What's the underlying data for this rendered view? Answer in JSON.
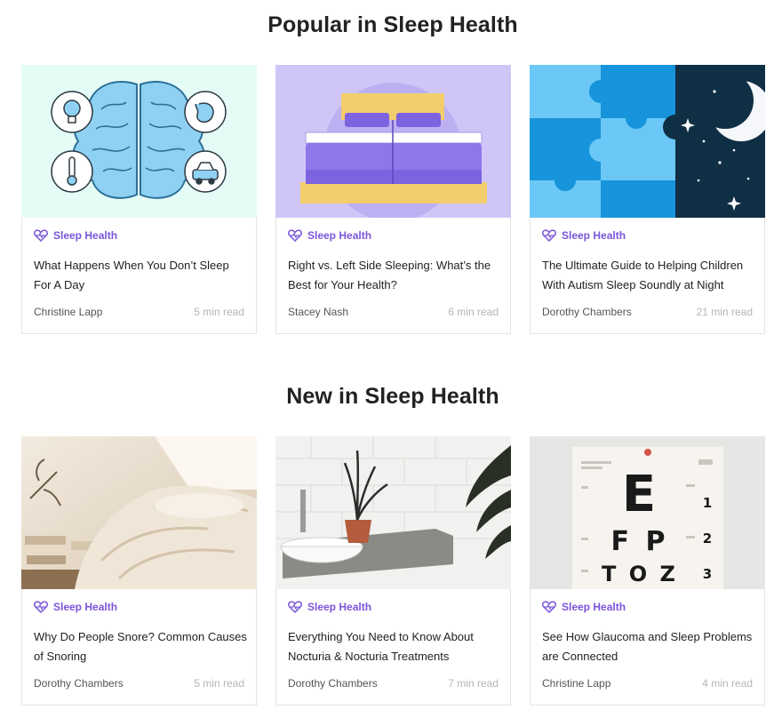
{
  "sections": [
    {
      "title": "Popular in Sleep Health",
      "cards": [
        {
          "category": "Sleep Health",
          "title": "What Happens When You Don’t Sleep For A Day",
          "author": "Christine Lapp",
          "read_time": "5 min read",
          "image": "brain-illustration"
        },
        {
          "category": "Sleep Health",
          "title": "Right vs. Left Side Sleeping: What’s the Best for Your Health?",
          "author": "Stacey Nash",
          "read_time": "6 min read",
          "image": "bed-illustration"
        },
        {
          "category": "Sleep Health",
          "title": "The Ultimate Guide to Helping Children With Autism Sleep Soundly at Night",
          "author": "Dorothy Chambers",
          "read_time": "21 min read",
          "image": "puzzle-moon-illustration"
        }
      ]
    },
    {
      "title": "New in Sleep Health",
      "cards": [
        {
          "category": "Sleep Health",
          "title": "Why Do People Snore? Common Causes of Snoring",
          "author": "Dorothy Chambers",
          "read_time": "5 min read",
          "image": "bedroom-photo"
        },
        {
          "category": "Sleep Health",
          "title": "Everything You Need to Know About Nocturia & Nocturia Treatments",
          "author": "Dorothy Chambers",
          "read_time": "7 min read",
          "image": "bathroom-sink-photo"
        },
        {
          "category": "Sleep Health",
          "title": "See How Glaucoma and Sleep Problems are Connected",
          "author": "Christine Lapp",
          "read_time": "4 min read",
          "image": "eye-chart-photo"
        }
      ]
    }
  ],
  "eye_chart": {
    "row1": "E",
    "row2": "F P",
    "row3": "T O Z",
    "numbers": [
      "1",
      "2",
      "3"
    ]
  },
  "colors": {
    "accent": "#7a55d9",
    "title": "#222222",
    "meta": "#555555",
    "muted": "#b5b5b5",
    "border": "#e4e4e4"
  }
}
